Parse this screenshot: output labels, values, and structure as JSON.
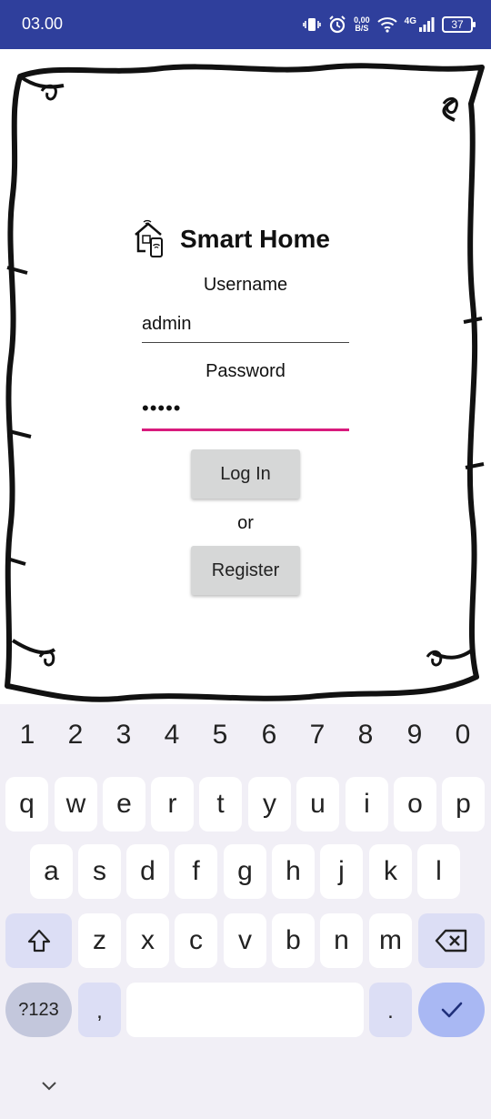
{
  "status_bar": {
    "time": "03.00",
    "net_speed_value": "0,00",
    "net_speed_unit": "B/S",
    "network_type": "4G",
    "battery": "37",
    "color": "#2f3f9c"
  },
  "app": {
    "title": "Smart Home",
    "username_label": "Username",
    "username_value": "admin",
    "password_label": "Password",
    "password_value": "•••••",
    "login_button": "Log In",
    "or_text": "or",
    "register_button": "Register",
    "focus_color": "#d81b7d"
  },
  "keyboard": {
    "numbers": [
      "1",
      "2",
      "3",
      "4",
      "5",
      "6",
      "7",
      "8",
      "9",
      "0"
    ],
    "row1": [
      "q",
      "w",
      "e",
      "r",
      "t",
      "y",
      "u",
      "i",
      "o",
      "p"
    ],
    "row2": [
      "a",
      "s",
      "d",
      "f",
      "g",
      "h",
      "j",
      "k",
      "l"
    ],
    "row3": [
      "z",
      "x",
      "c",
      "v",
      "b",
      "n",
      "m"
    ],
    "symbols_key": "?123",
    "comma_key": ",",
    "period_key": "."
  }
}
